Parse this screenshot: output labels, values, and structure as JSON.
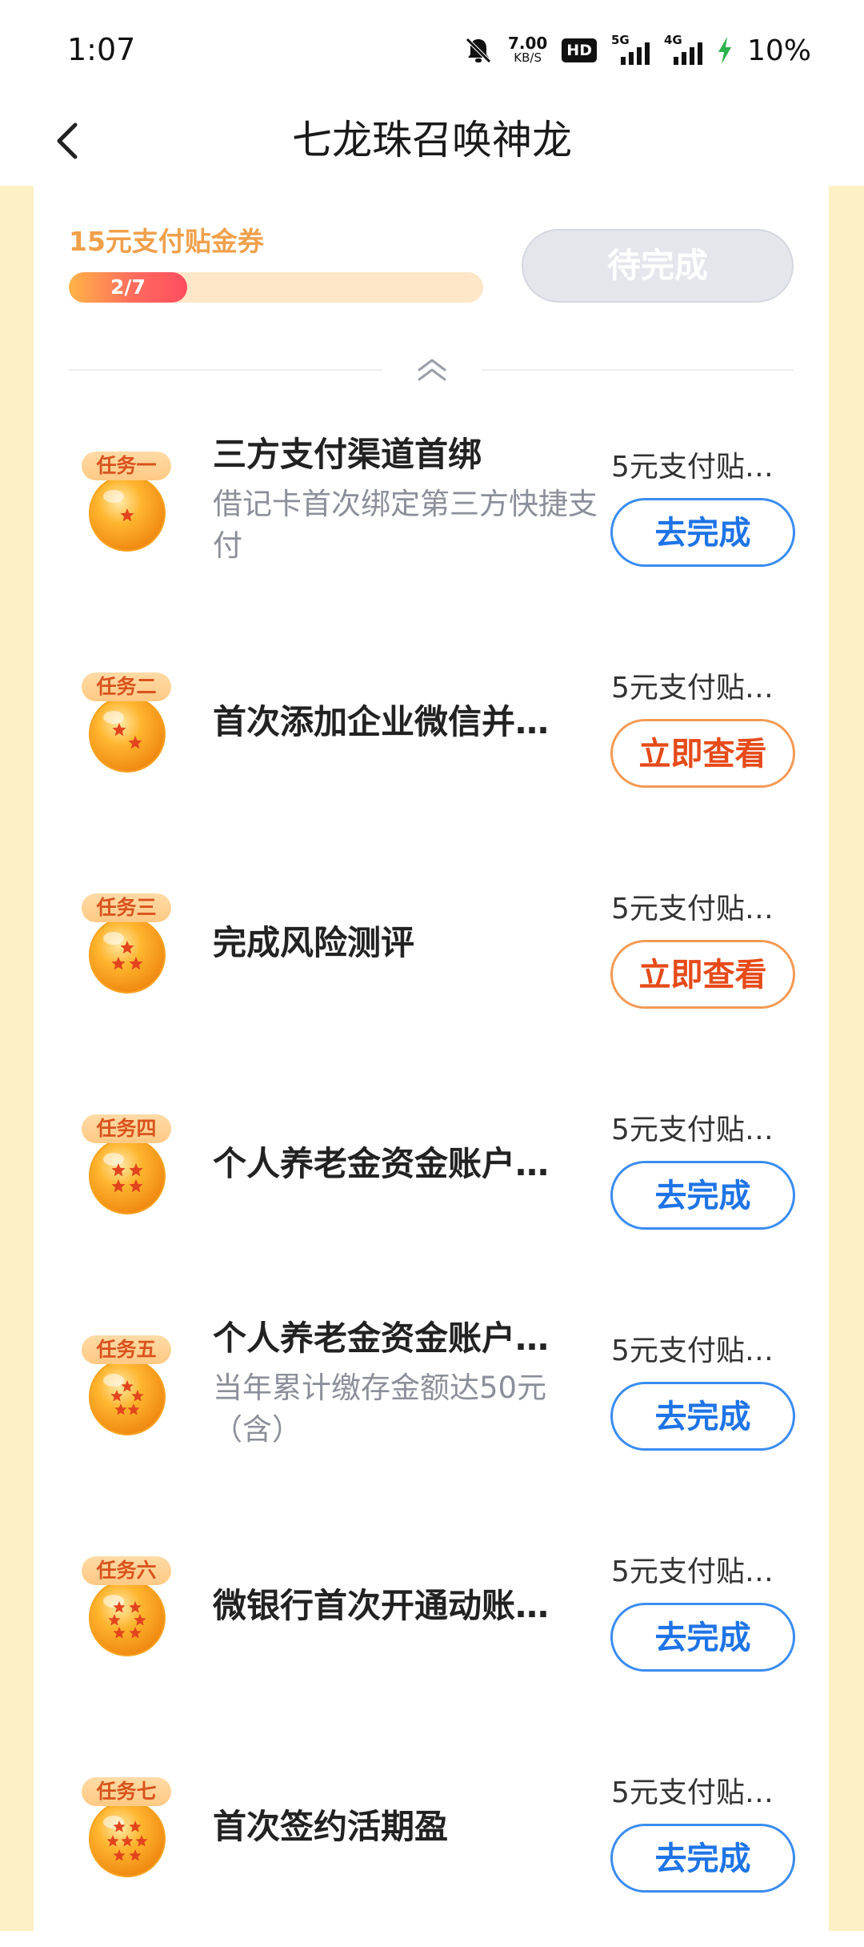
{
  "status_bar": {
    "time": "1:07",
    "net_speed_value": "7.00",
    "net_speed_unit": "KB/S",
    "hd_label": "HD",
    "signal_1_label": "5G",
    "signal_2_label": "4G",
    "battery": "10%"
  },
  "header": {
    "title": "七龙珠召唤神龙"
  },
  "progress": {
    "reward_title": "15元支付贴金券",
    "progress_text": "2/7",
    "completed": 2,
    "total": 7,
    "status_button": "待完成"
  },
  "tasks": [
    {
      "badge": "任务一",
      "stars": 1,
      "title": "三方支付渠道首绑",
      "desc": "借记卡首次绑定第三方快捷支付",
      "reward": "5元支付贴…",
      "button": "去完成",
      "button_style": "blue"
    },
    {
      "badge": "任务二",
      "stars": 2,
      "title": "首次添加企业微信并…",
      "desc": "",
      "reward": "5元支付贴…",
      "button": "立即查看",
      "button_style": "orange"
    },
    {
      "badge": "任务三",
      "stars": 3,
      "title": "完成风险测评",
      "desc": "",
      "reward": "5元支付贴…",
      "button": "立即查看",
      "button_style": "orange"
    },
    {
      "badge": "任务四",
      "stars": 4,
      "title": "个人养老金资金账户…",
      "desc": "",
      "reward": "5元支付贴…",
      "button": "去完成",
      "button_style": "blue"
    },
    {
      "badge": "任务五",
      "stars": 5,
      "title": "个人养老金资金账户…",
      "desc": "当年累计缴存金额达50元（含）",
      "reward": "5元支付贴…",
      "button": "去完成",
      "button_style": "blue"
    },
    {
      "badge": "任务六",
      "stars": 6,
      "title": "微银行首次开通动账…",
      "desc": "",
      "reward": "5元支付贴…",
      "button": "去完成",
      "button_style": "blue"
    },
    {
      "badge": "任务七",
      "stars": 7,
      "title": "首次签约活期盈",
      "desc": "",
      "reward": "5元支付贴…",
      "button": "去完成",
      "button_style": "blue"
    }
  ],
  "colors": {
    "accent_blue": "#1e74e6",
    "accent_orange": "#e64a19",
    "reward_title": "#f0a04b",
    "page_background": "#fdf0c4"
  },
  "icons": {
    "back": "back-arrow-icon",
    "collapse": "chevron-double-up-icon",
    "ball": "dragon-ball-icon"
  }
}
